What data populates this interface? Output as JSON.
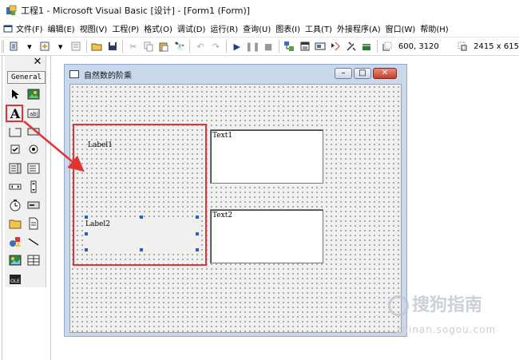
{
  "window": {
    "title": "工程1 - Microsoft Visual Basic [设计] - [Form1 (Form)]"
  },
  "menu": {
    "items": [
      "文件(F)",
      "编辑(E)",
      "视图(V)",
      "工程(P)",
      "格式(O)",
      "调试(D)",
      "运行(R)",
      "查询(U)",
      "图表(I)",
      "工具(T)",
      "外接程序(A)",
      "窗口(W)",
      "帮助(H)"
    ]
  },
  "toolbar": {
    "position_readout": "600, 3120",
    "size_readout": "2415 x 615"
  },
  "toolbox": {
    "tab_label": "General",
    "close_glyph": "✕"
  },
  "form": {
    "title": "自然数的阶乘",
    "label1": "Label1",
    "label2": "Label2",
    "text1": "Text1",
    "text2": "Text2"
  },
  "watermark": {
    "brand": "搜狗指南",
    "url": "zhinan.sogou.com"
  },
  "colors": {
    "highlight": "#e03434",
    "selection_handle": "#2a5cd0",
    "form_frame": "#c9d8ea"
  }
}
